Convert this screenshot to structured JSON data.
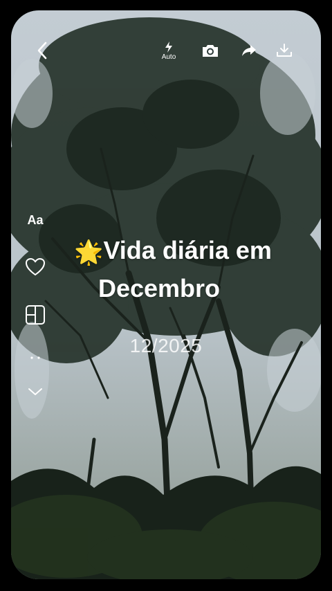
{
  "toolbar": {
    "back_icon": "chevron-left-icon",
    "flash_label": "Auto",
    "flash_icon": "flash-icon",
    "camera_icon": "camera-icon",
    "share_icon": "share-icon",
    "download_icon": "download-icon"
  },
  "side_tools": {
    "text_tool_label": "Aa",
    "sticker_icon": "heart-icon",
    "layout_icon": "layout-icon",
    "more_icon": "more-icon",
    "collapse_icon": "chevron-down-icon"
  },
  "overlay": {
    "title_emoji": "🌟",
    "title_line1": "Vida diária em",
    "title_line2": "Decembro",
    "date": "12/2025"
  },
  "colors": {
    "frame_bg": "#000000",
    "sky": "#c9d2d8",
    "foliage": "#1e2a22",
    "text": "#ffffff"
  }
}
